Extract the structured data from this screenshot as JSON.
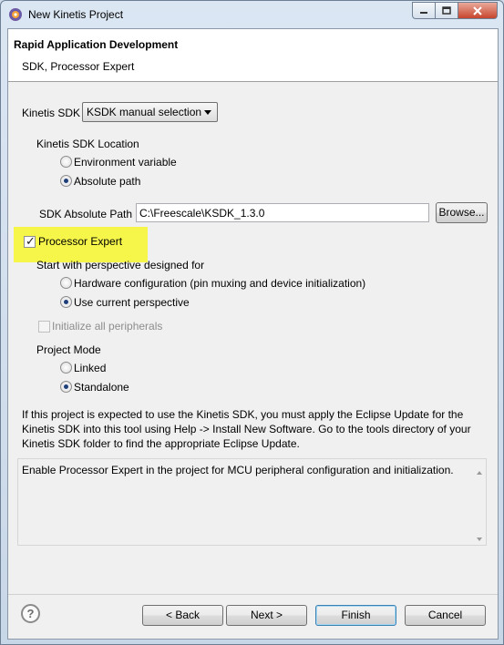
{
  "window": {
    "title": "New Kinetis Project"
  },
  "header": {
    "title": "Rapid Application Development",
    "subtitle": "SDK, Processor Expert"
  },
  "kinetis_sdk": {
    "label": "Kinetis SDK",
    "selected": "KSDK manual selection"
  },
  "sdk_location": {
    "label": "Kinetis SDK Location",
    "options": [
      "Environment variable",
      "Absolute path"
    ],
    "selected_index": 1
  },
  "sdk_path": {
    "label": "SDK Absolute Path",
    "value": "C:\\Freescale\\KSDK_1.3.0",
    "browse_label": "Browse..."
  },
  "processor_expert": {
    "label": "Processor Expert",
    "checked": true,
    "highlight_color": "#f6f64a"
  },
  "perspective": {
    "label": "Start with perspective designed for",
    "options": [
      "Hardware configuration (pin muxing and device initialization)",
      "Use current perspective"
    ],
    "selected_index": 1
  },
  "init_peripherals": {
    "label": "Initialize all peripherals",
    "checked": false,
    "enabled": false
  },
  "project_mode": {
    "label": "Project Mode",
    "options": [
      "Linked",
      "Standalone"
    ],
    "selected_index": 1
  },
  "info_text": "If this project is expected to use the Kinetis SDK, you must apply the Eclipse Update for the Kinetis SDK into this tool using Help -> Install New Software. Go to the tools directory of your Kinetis SDK folder to find the appropriate Eclipse Update.",
  "description": "Enable Processor Expert in the project for MCU peripheral configuration and initialization.",
  "footer": {
    "help_icon": "help-icon",
    "back_label": "< Back",
    "next_label": "Next >",
    "finish_label": "Finish",
    "cancel_label": "Cancel"
  },
  "colors": {
    "accent": "#3c7fb1"
  }
}
